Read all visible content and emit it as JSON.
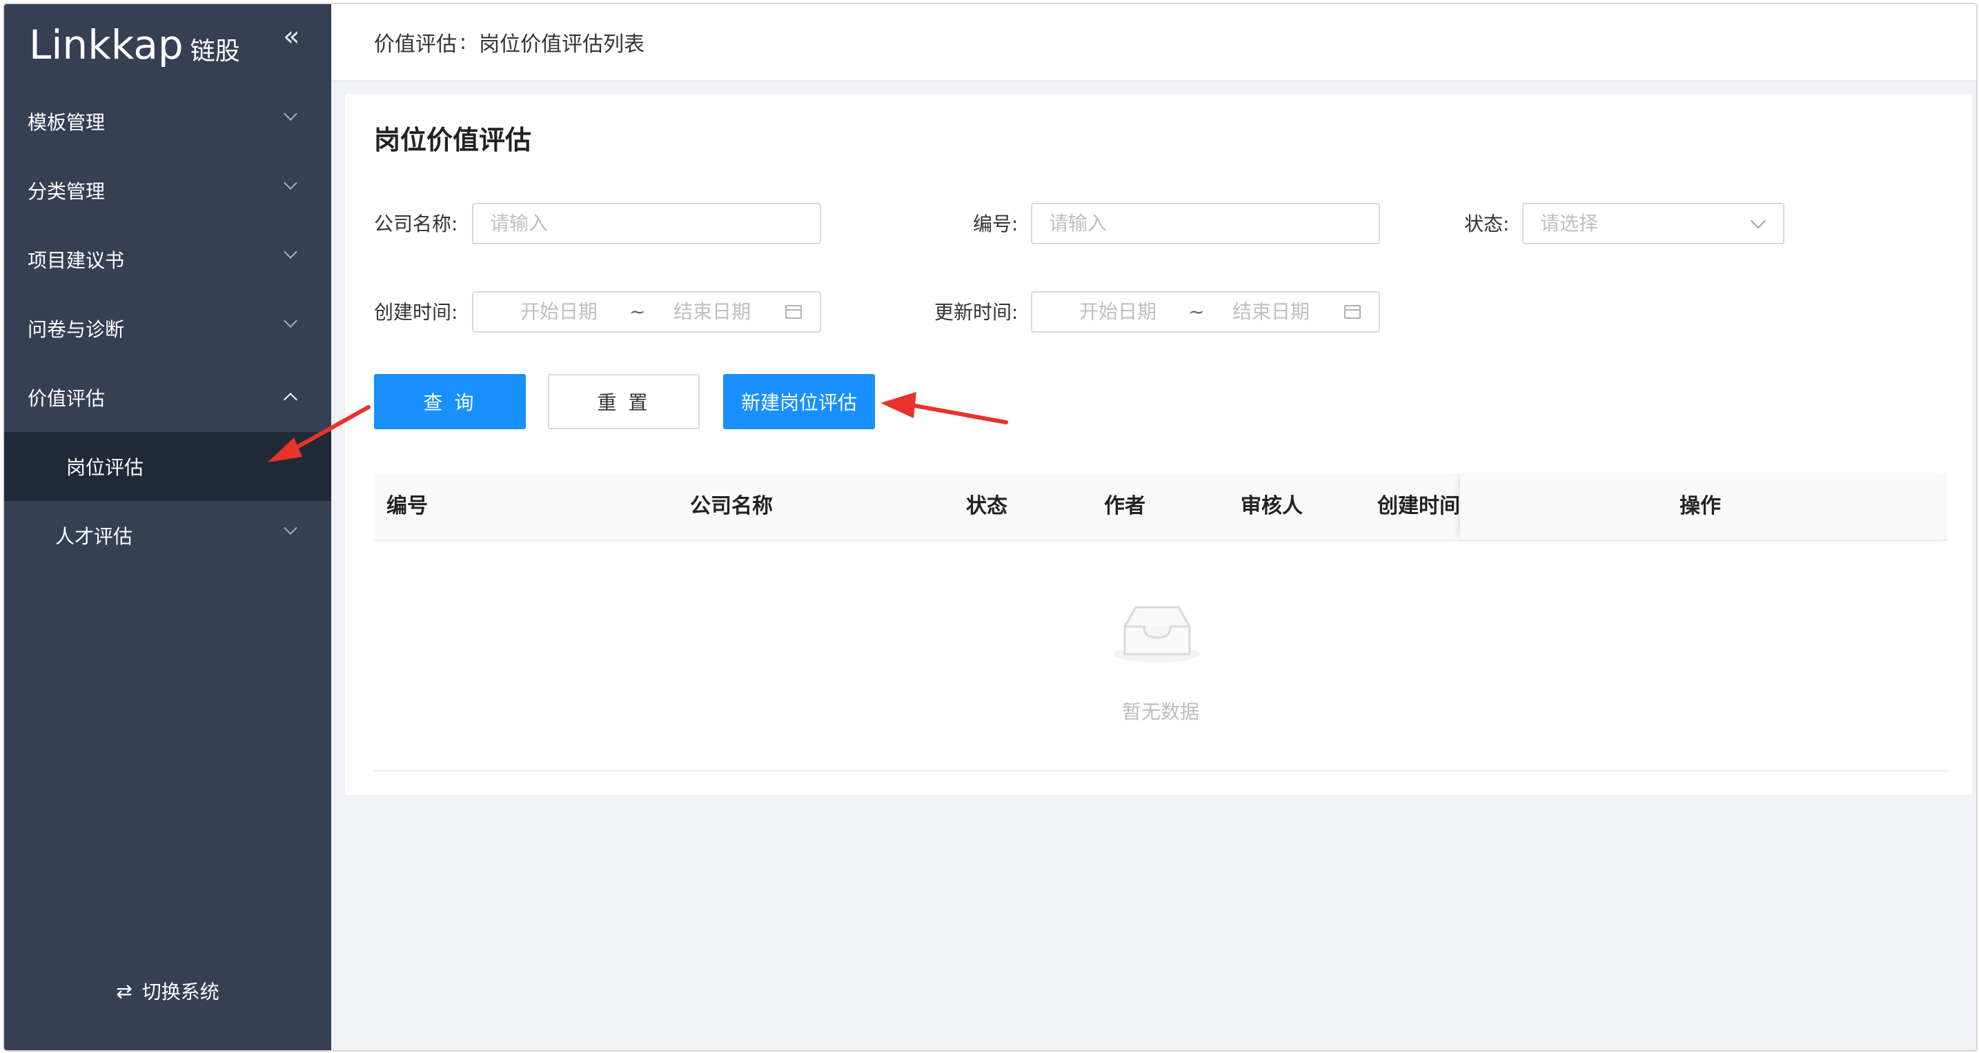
{
  "sidebar": {
    "logo_text": "Linkkap",
    "logo_sub": "链股",
    "collapse_glyph": "«",
    "items": [
      {
        "label": "模板管理"
      },
      {
        "label": "分类管理"
      },
      {
        "label": "项目建议书"
      },
      {
        "label": "问卷与诊断"
      },
      {
        "label": "价值评估"
      },
      {
        "label": "岗位评估"
      },
      {
        "label": "人才评估"
      }
    ],
    "switch_label": "切换系统",
    "switch_glyph": "⇄"
  },
  "header": {
    "section": "价值评估",
    "separator": ":",
    "current": "岗位价值评估列表"
  },
  "main": {
    "title": "岗位价值评估",
    "filters": {
      "company_label": "公司名称:",
      "company_placeholder": "请输入",
      "code_label": "编号:",
      "code_placeholder": "请输入",
      "status_label": "状态:",
      "status_placeholder": "请选择",
      "created_label": "创建时间:",
      "updated_label": "更新时间:",
      "start_placeholder": "开始日期",
      "end_placeholder": "结束日期",
      "range_sep": "~"
    },
    "buttons": {
      "query": "查 询",
      "reset": "重 置",
      "new": "新建岗位评估"
    },
    "table": {
      "columns": [
        "编号",
        "公司名称",
        "状态",
        "作者",
        "审核人",
        "创建时间",
        "操作"
      ],
      "empty_text": "暂无数据"
    }
  },
  "colors": {
    "sidebar_bg": "#354052",
    "sidebar_active": "#1f2a36",
    "primary": "#1890ff",
    "annotation": "#e8322c"
  }
}
